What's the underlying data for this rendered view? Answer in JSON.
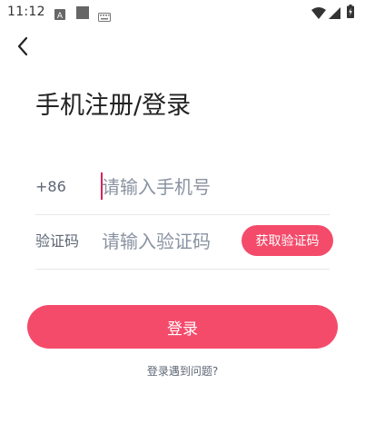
{
  "status_bar": {
    "time": "11:12",
    "left_icons": [
      "a-notification-icon",
      "square-notification-icon",
      "keyboard-icon"
    ],
    "right_icons": [
      "wifi-icon",
      "cell-signal-icon",
      "battery-charging-icon"
    ]
  },
  "nav": {
    "back_icon": "chevron-left-icon"
  },
  "page": {
    "title": "手机注册/登录"
  },
  "form": {
    "phone": {
      "prefix": "+86",
      "value": "",
      "placeholder": "请输入手机号"
    },
    "code": {
      "label": "验证码",
      "value": "",
      "placeholder": "请输入验证码",
      "get_code_label": "获取验证码"
    }
  },
  "actions": {
    "login_label": "登录",
    "help_link": "登录遇到问题?"
  },
  "colors": {
    "accent": "#f44b6b",
    "caret": "#d6245c",
    "label": "#5d6675",
    "placeholder": "#8a93a2"
  }
}
